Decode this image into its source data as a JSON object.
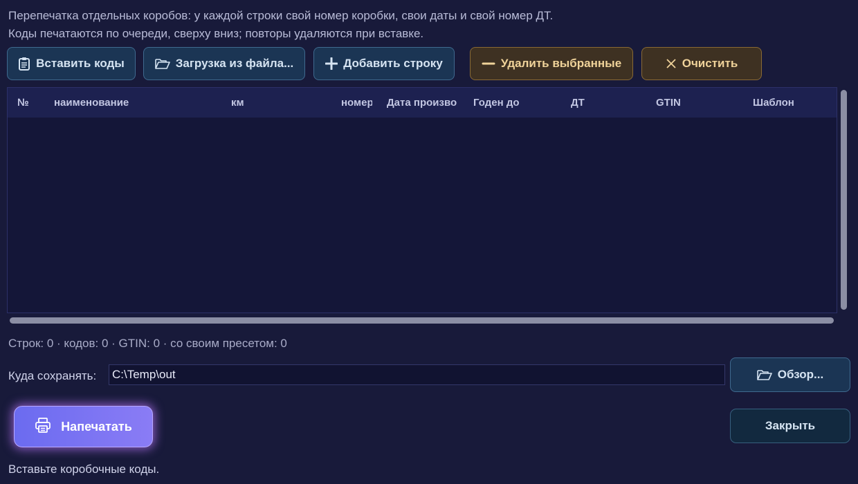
{
  "description": {
    "line1": "Перепечатка отдельных коробов: у каждой строки свой номер коробки, свои даты и свой номер ДТ.",
    "line2": "Коды печатаются по очереди, сверху вниз; повторы удаляются при вставке."
  },
  "toolbar": {
    "paste_label": "Вставить коды",
    "paste_icon": "clipboard-icon",
    "load_label": "Загрузка из файла...",
    "load_icon": "folder-icon",
    "add_label": "Добавить строку",
    "add_icon": "plus-icon",
    "delete_label": "Удалить выбранные",
    "delete_icon": "minus-icon",
    "clear_label": "Очистить",
    "clear_icon": "x-icon"
  },
  "table": {
    "columns": [
      "№",
      "наименование",
      "км",
      "номер",
      "Дата произво",
      "Годен до",
      "ДТ",
      "GTIN",
      "Шаблон"
    ],
    "rows": []
  },
  "counts_text": "Строк: 0 · кодов: 0 · GTIN: 0 · со своим пресетом: 0",
  "save": {
    "label": "Куда сохранять:",
    "value": "C:\\Temp\\out",
    "browse_label": "Обзор...",
    "browse_icon": "folder-icon"
  },
  "print_label": "Напечатать",
  "print_icon": "printer-icon",
  "close_label": "Закрыть",
  "status_text": "Вставьте коробочные коды.",
  "colors": {
    "background": "#181a3a",
    "primary_accent": "#7b74f2",
    "blue_button": "#1b3554",
    "gold_button": "#3e3122",
    "gold_text": "#f0d39a"
  }
}
